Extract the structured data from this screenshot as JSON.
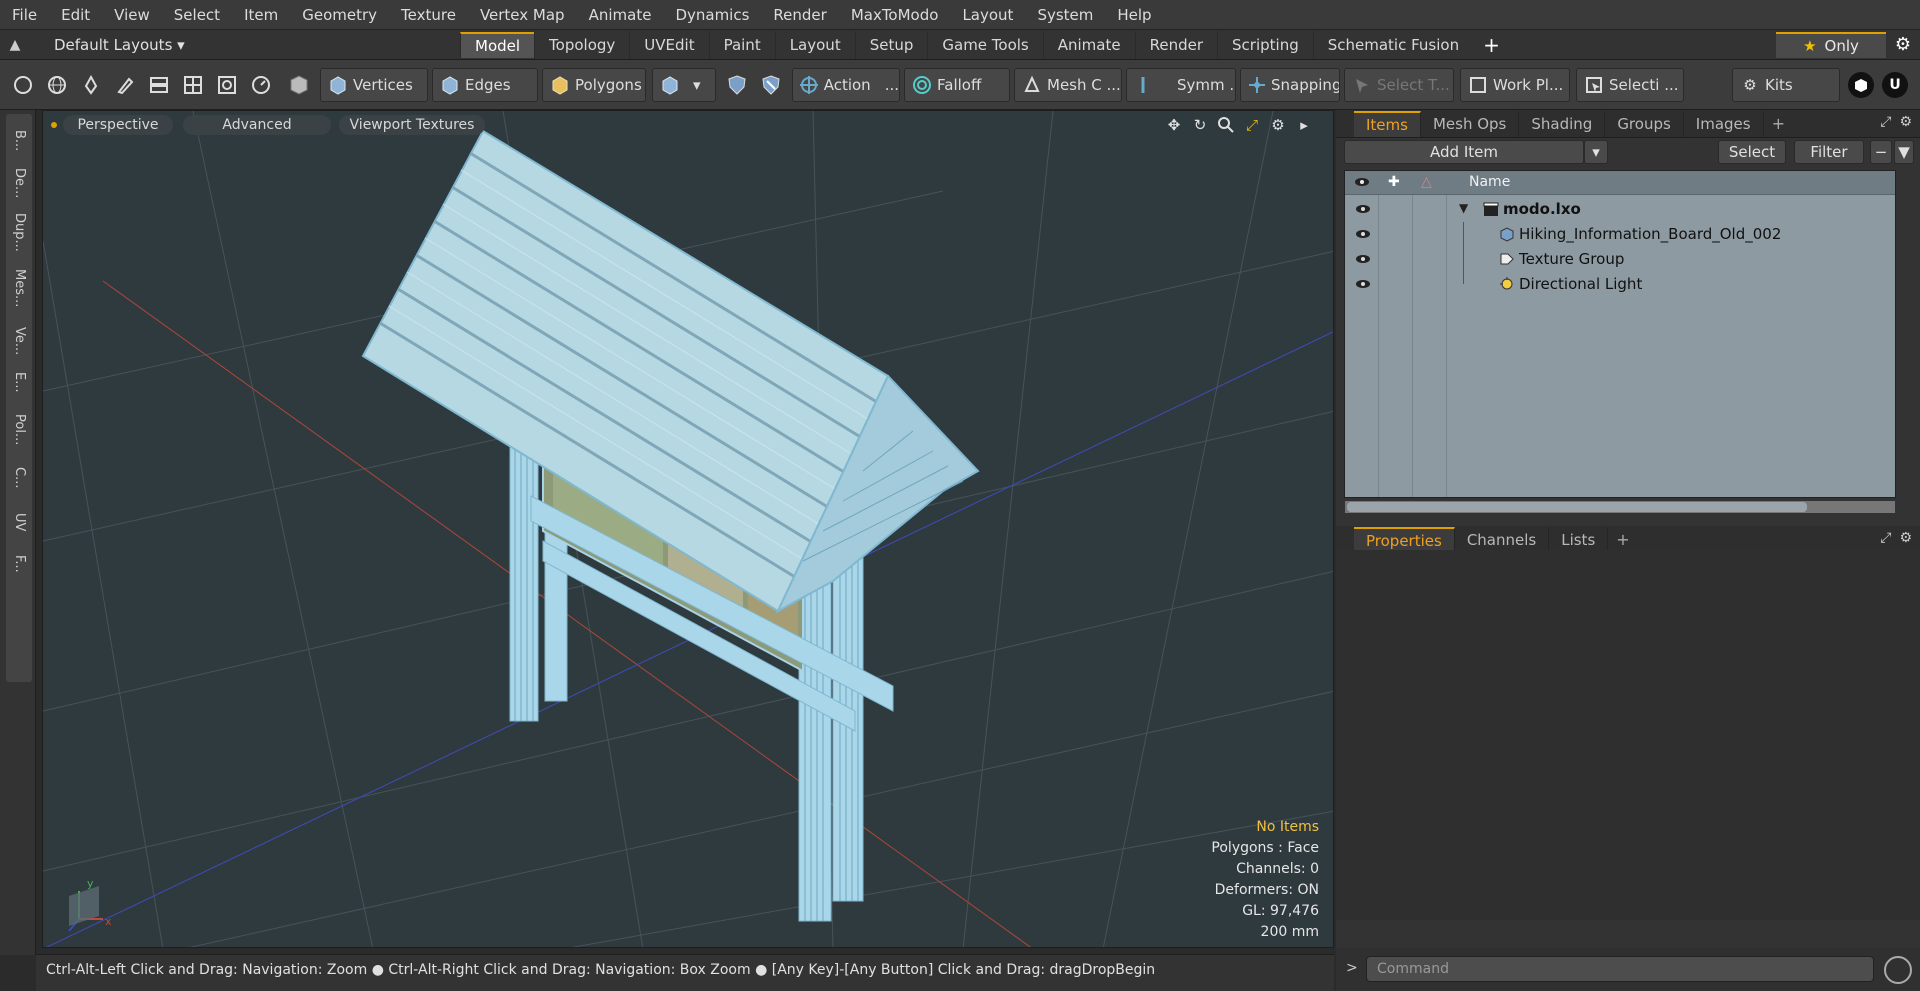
{
  "menu": [
    "File",
    "Edit",
    "View",
    "Select",
    "Item",
    "Geometry",
    "Texture",
    "Vertex Map",
    "Animate",
    "Dynamics",
    "Render",
    "MaxToModo",
    "Layout",
    "System",
    "Help"
  ],
  "layout_selector": "Default Layouts",
  "layout_tabs": [
    "Model",
    "Topology",
    "UVEdit",
    "Paint",
    "Layout",
    "Setup",
    "Game Tools",
    "Animate",
    "Render",
    "Scripting",
    "Schematic Fusion"
  ],
  "active_layout_tab": "Model",
  "only_label": "Only",
  "toolbar": {
    "vertices": "Vertices",
    "edges": "Edges",
    "polygons": "Polygons",
    "action": "Action",
    "falloff": "Falloff",
    "mesh_c": "Mesh C ...",
    "symm": "Symm ...",
    "snapping": "Snapping",
    "select_t": "Select T...",
    "work_pl": "Work Pl...",
    "selecti": "Selecti ...",
    "kits": "Kits"
  },
  "left_tabs": [
    "B...",
    "De...",
    "Dup...",
    "Mes...",
    "Ve...",
    "E...",
    "Pol...",
    "C...",
    "UV",
    "F..."
  ],
  "viewport": {
    "perspective": "Perspective",
    "advanced": "Advanced",
    "viewport_textures": "Viewport Textures",
    "stats": {
      "no_items": "No Items",
      "polygons": "Polygons : Face",
      "channels": "Channels: 0",
      "deformers": "Deformers: ON",
      "gl": "GL: 97,476",
      "scale": "200 mm"
    }
  },
  "status_bar": "Ctrl-Alt-Left Click and Drag: Navigation: Zoom ● Ctrl-Alt-Right Click and Drag: Navigation: Box Zoom ● [Any Key]-[Any Button] Click and Drag: dragDropBegin",
  "items_panel": {
    "tabs": [
      "Items",
      "Mesh Ops",
      "Shading",
      "Groups",
      "Images"
    ],
    "active_tab": "Items",
    "add_item": "Add Item",
    "select": "Select",
    "filter": "Filter",
    "column_name": "Name",
    "items": [
      {
        "label": "modo.lxo",
        "icon": "scene-icon"
      },
      {
        "label": "Hiking_Information_Board_Old_002",
        "icon": "mesh-icon"
      },
      {
        "label": "Texture Group",
        "icon": "texture-group-icon"
      },
      {
        "label": "Directional Light",
        "icon": "light-icon"
      }
    ]
  },
  "properties_panel": {
    "tabs": [
      "Properties",
      "Channels",
      "Lists"
    ],
    "active_tab": "Properties"
  },
  "command": {
    "prompt": ">",
    "placeholder": "Command"
  },
  "colors": {
    "accent": "#e0a000",
    "viewport_bg": "#2f3a3e",
    "wire": "#a8d4e6",
    "axis_x": "#c04a3a",
    "axis_z": "#3a4ac0"
  }
}
